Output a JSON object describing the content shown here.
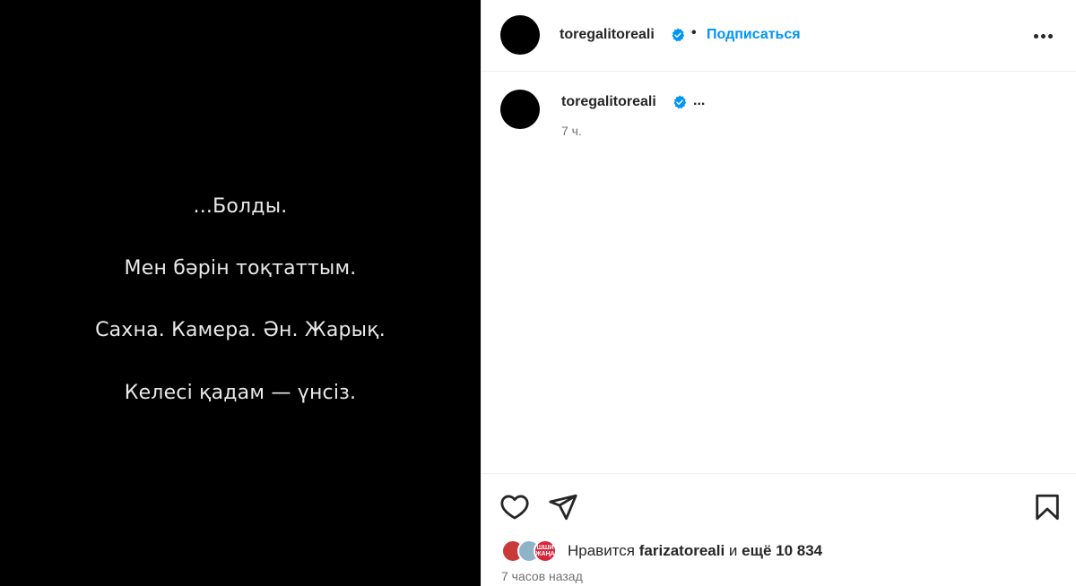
{
  "media": {
    "lines": [
      "...Болды.",
      "Мен бәрін тоқтаттым.",
      "Сахна. Камера. Ән. Жарық.",
      "Келесі қадам — үнсіз."
    ]
  },
  "header": {
    "username": "toregalitoreali",
    "separator": "•",
    "follow_label": "Подписаться",
    "more_icon": "more-horizontal-icon"
  },
  "caption": {
    "username": "toregalitoreali",
    "text": "...",
    "time": "7 ч."
  },
  "actions": {
    "like_icon": "heart-icon",
    "share_icon": "paper-plane-icon",
    "save_icon": "bookmark-icon"
  },
  "likes": {
    "prefix": "Нравится",
    "user": "farizatoreali",
    "connector": "и",
    "more": "ещё 10 834",
    "badge_text": "ШШИ ЖАҢА"
  },
  "post_date": "7 часов назад",
  "colors": {
    "accent": "#0095f6",
    "verified": "#0095f6",
    "text": "#262626",
    "muted": "#737373"
  }
}
